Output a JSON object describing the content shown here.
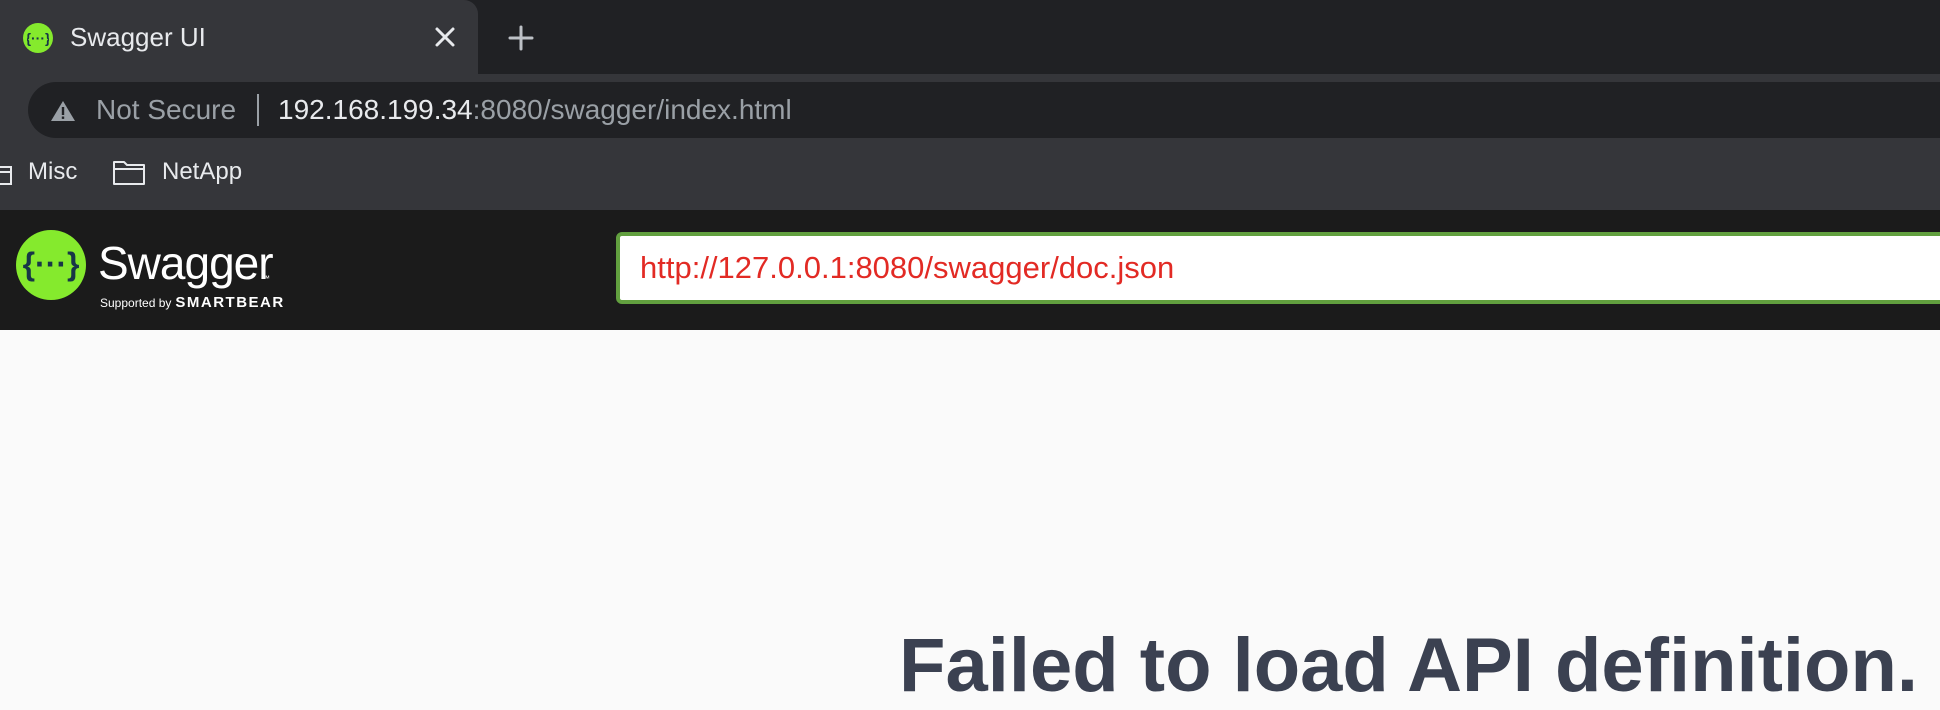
{
  "browser": {
    "tab": {
      "title": "Swagger UI",
      "favicon": "swagger-favicon-icon"
    },
    "new_tab_icon": "plus-icon",
    "address": {
      "security_label": "Not Secure",
      "url_host": "192.168.199.34",
      "url_rest": ":8080/swagger/index.html"
    },
    "bookmarks": [
      {
        "label": "Misc",
        "icon": "folder-icon"
      },
      {
        "label": "NetApp",
        "icon": "folder-icon"
      }
    ]
  },
  "swagger": {
    "brand": "Swagger",
    "trademark": "™",
    "supported_by": "Supported by",
    "sponsor": "SMARTBEAR",
    "spec_url": "http://127.0.0.1:8080/swagger/doc.json"
  },
  "main": {
    "error_message": "Failed to load API definition."
  },
  "colors": {
    "swagger_green": "#85ea2d",
    "input_border": "#62a03f",
    "input_text": "#e22a24",
    "error_text": "#3b4151",
    "topbar_bg": "#1b1b1b"
  }
}
